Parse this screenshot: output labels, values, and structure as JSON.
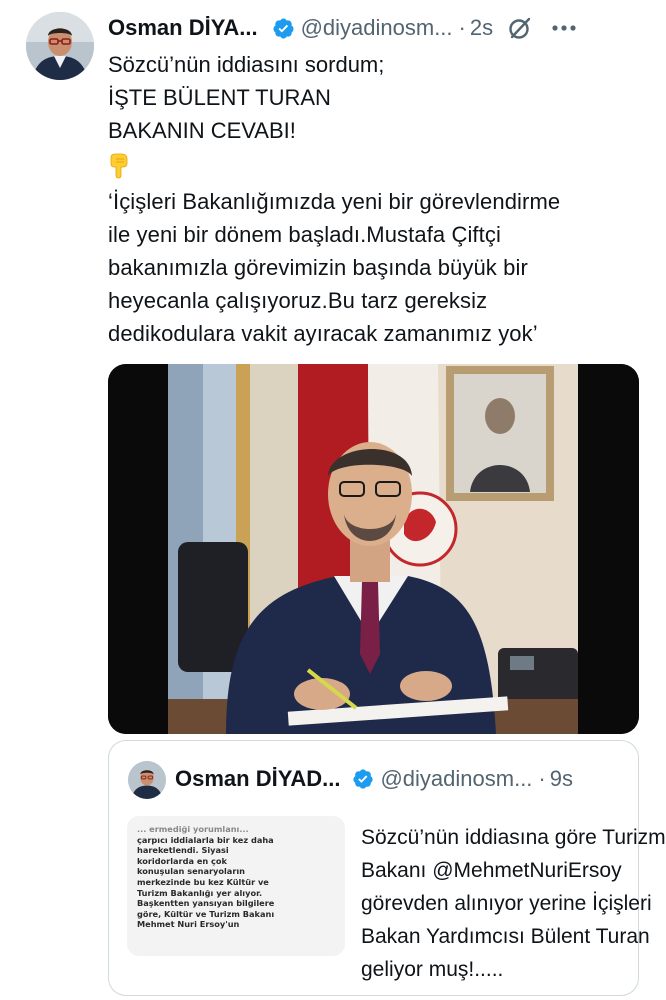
{
  "tweet": {
    "author_name": "Osman DİYA...",
    "handle": "@diyadinosm...",
    "separator": "·",
    "time": "2s",
    "text_lines": [
      "Sözcü’nün iddiasını sordum;",
      "İŞTE BÜLENT TURAN",
      "BAKANIN CEVABI!"
    ],
    "emoji": "pointing-down-emoji",
    "quote_lines": [
      "‘İçişleri Bakanlığımızda yeni bir görevlendirme",
      "ile yeni bir dönem başladı.Mustafa Çiftçi",
      "bakanımızla görevimizin başında büyük bir",
      "heyecanla çalışıyoruz.Bu tarz gereksiz",
      "dedikodulara vakit ayıracak zamanımız yok’"
    ]
  },
  "quoted_tweet": {
    "author_name": "Osman DİYAD...",
    "handle": "@diyadinosm...",
    "separator": "·",
    "time": "9s",
    "thumb_lines": [
      "... ermediği yorumlanı...",
      "çarpıcı iddialarla bir kez daha",
      "hareketlendi. Siyasi",
      "koridorlarda en çok",
      "konuşulan senaryoların",
      "merkezinde bu kez Kültür ve",
      "Turizm Bakanlığı yer alıyor.",
      "Başkentten yansıyan bilgilere",
      "göre, Kültür ve Turizm Bakanı",
      "Mehmet Nuri Ersoy'un"
    ],
    "body_lines": [
      "Sözcü’nün iddiasına göre Turizm",
      "Bakanı @MehmetNuriErsoy",
      "görevden alınıyor yerine İçişleri",
      "Bakan Yardımcısı Bülent Turan",
      "geliyor muş!....."
    ]
  },
  "colors": {
    "text": "#0f1419",
    "secondary": "#536471",
    "verified": "#1d9bf0",
    "border": "#cfd9de"
  }
}
